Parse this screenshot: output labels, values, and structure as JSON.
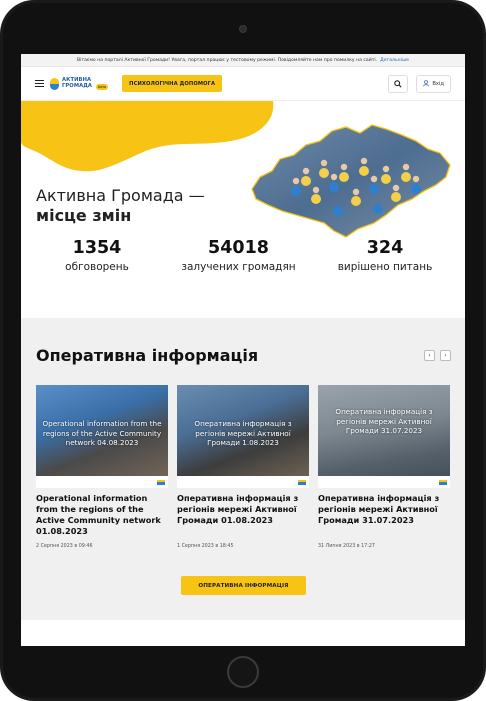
{
  "notice": {
    "text": "Вітаємо на порталі Активної Громади! Увага, портал працює у тестовому режимі. Повідомляйте нам про помилку на сайті.",
    "link": "Детальніше"
  },
  "header": {
    "logo_line1": "АКТИВНА",
    "logo_line2": "ГРОМАДА",
    "logo_badge": "beta",
    "help_button": "ПСИХОЛОГІЧНА ДОПОМОГА",
    "login_button": "Вхід"
  },
  "hero": {
    "title_line1": "Активна Громада —",
    "title_line2": "місце змін",
    "stats": [
      {
        "value": "1354",
        "label": "обговорень"
      },
      {
        "value": "54018",
        "label": "залучених громадян"
      },
      {
        "value": "324",
        "label": "вирішено питань"
      }
    ]
  },
  "ops": {
    "title": "Оперативна інформація",
    "button": "ОПЕРАТИВНА ІНФОРМАЦІЯ",
    "cards": [
      {
        "overlay": "Operational information from the regions of the Active Community network 04.08.2023",
        "title": "Operational information from the regions of the Active Community network 01.08.2023",
        "date": "2 Серпня 2023 в 09:46"
      },
      {
        "overlay": "Оперативна інформація з регіонів мережі Активної Громади 1.08.2023",
        "title": "Оперативна інформація з регіонів мережі Активної Громади 01.08.2023",
        "date": "1 Серпня 2023 в 18:45"
      },
      {
        "overlay": "Оперативна інформація з регіонів мережі Активної Громади 31.07.2023",
        "title": "Оперативна інформація з регіонів мережі Активної Громади 31.07.2023",
        "date": "31 Липня 2023 в 17:27"
      }
    ]
  },
  "colors": {
    "accent": "#f7c315",
    "brand_blue": "#2d7fd1",
    "section_bg": "#f0f0f0"
  },
  "icons": {
    "menu": "hamburger-icon",
    "search": "search-icon",
    "user": "user-icon",
    "prev": "chevron-left-icon",
    "next": "chevron-right-icon"
  }
}
